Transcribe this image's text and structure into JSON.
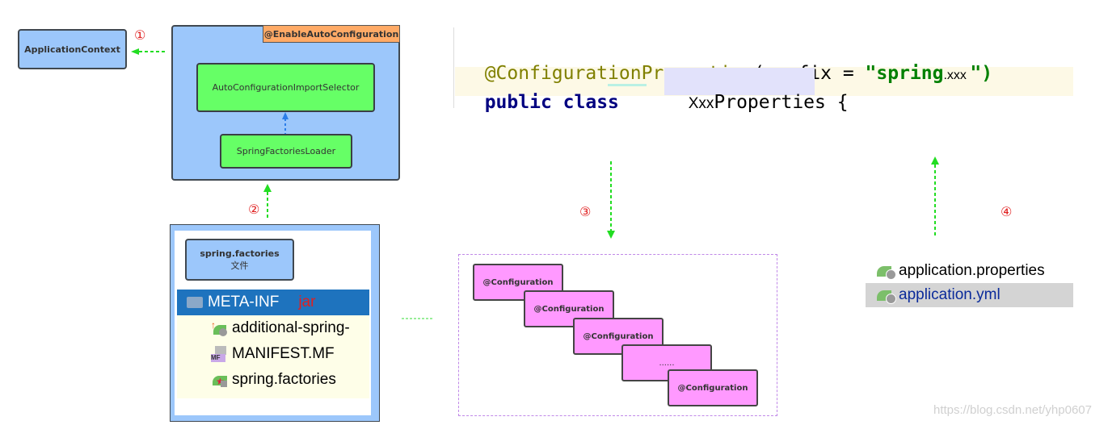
{
  "left_diagram": {
    "application_context": "ApplicationContext",
    "enable_auto_config_label": "@EnableAutoConfiguration",
    "import_selector": "AutoConfigurationImportSelector",
    "factories_loader": "SpringFactoriesLoader",
    "step1": "①",
    "step2": "②"
  },
  "jar_panel": {
    "file_label_line1": "spring.factories",
    "file_label_line2": "文件",
    "folder": "META-INF",
    "jar_tag": "jar",
    "files": [
      {
        "name": "additional-spring-",
        "icon": "spring-config-icon"
      },
      {
        "name": "MANIFEST.MF",
        "icon": "manifest-icon"
      },
      {
        "name": "spring.factories",
        "icon": "spring-factories-icon"
      }
    ]
  },
  "code": {
    "annotation": "@ConfigurationProperties",
    "open_paren": "(",
    "param": "prefix",
    "equals": " = ",
    "string_open": "\"spring",
    "string_suffix": ".xxx ",
    "string_close": "\")",
    "kw_public": "public",
    "kw_class": "class",
    "class_prefix": "Xxx",
    "class_name": "Properties",
    "brace": "{"
  },
  "config_group": {
    "items": [
      "@Configuration",
      "@Configuration",
      "@Configuration",
      "......",
      "@Configuration"
    ],
    "step3": "③"
  },
  "config_files": {
    "step4": "④",
    "files": [
      {
        "name": "application.properties",
        "selected": false
      },
      {
        "name": "application.yml",
        "selected": true
      }
    ]
  },
  "watermark": "https://blog.csdn.net/yhp0607",
  "colors": {
    "box_blue": "#9cc7fb",
    "box_green": "#66ff66",
    "box_pink": "#ff99ff",
    "label_orange": "#ffaa66",
    "step_red": "#e02020",
    "arrow_green": "#22dd22",
    "selection_blue": "#1e73be"
  }
}
